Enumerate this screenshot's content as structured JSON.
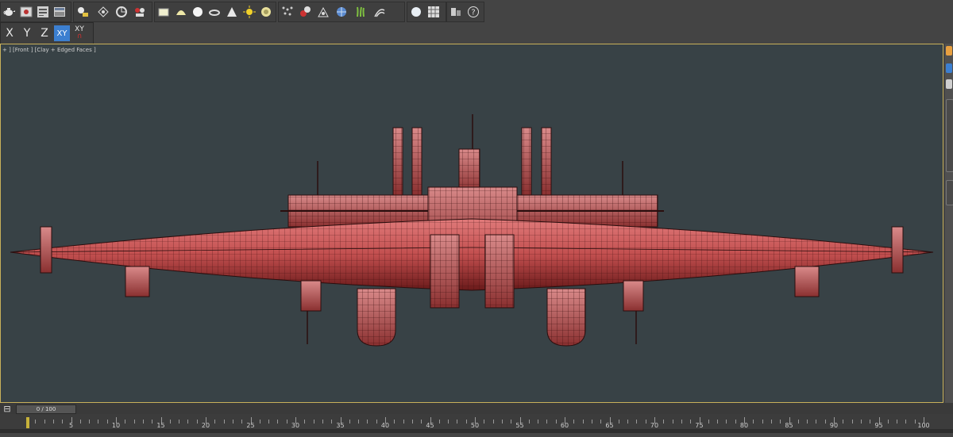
{
  "toolbar": {
    "icons": [
      "teapot-icon",
      "render-setup-icon",
      "render-frame-icon",
      "rendered-frame-window-icon",
      "light-lister-icon",
      "helper-icon",
      "camera-icon",
      "shader-ball-icon",
      "box-icon",
      "sphere-icon",
      "torus-icon",
      "cone-icon",
      "pyramid-icon",
      "sun-icon",
      "sphere-gizmo-icon",
      "particle-icon",
      "material-editor-icon",
      "bone-icon",
      "globe-icon",
      "hair-icon",
      "twist-icon",
      "environment-icon",
      "grid-icon",
      "layer-icon",
      "help-icon"
    ]
  },
  "axis_constraints": {
    "x_label": "X",
    "y_label": "Y",
    "z_label": "Z",
    "xy_label": "XY",
    "xy_toggle_label": "XY"
  },
  "viewport": {
    "label": "+ ] [Front ] [Clay + Edged Faces ]",
    "model_color": "#c55b5b",
    "wire_color": "#3a0d0d"
  },
  "timeline": {
    "frame_display": "0 / 100",
    "ticks": [
      5,
      10,
      15,
      20,
      25,
      30,
      35,
      40,
      45,
      50,
      55,
      60,
      65,
      70,
      75,
      80,
      85,
      90,
      95,
      100
    ],
    "current_frame": 0,
    "max_frame": 100
  },
  "colors": {
    "active_axis": "#3c7fd0",
    "viewport_border": "#c8b05a",
    "viewport_bg": "#384246"
  }
}
